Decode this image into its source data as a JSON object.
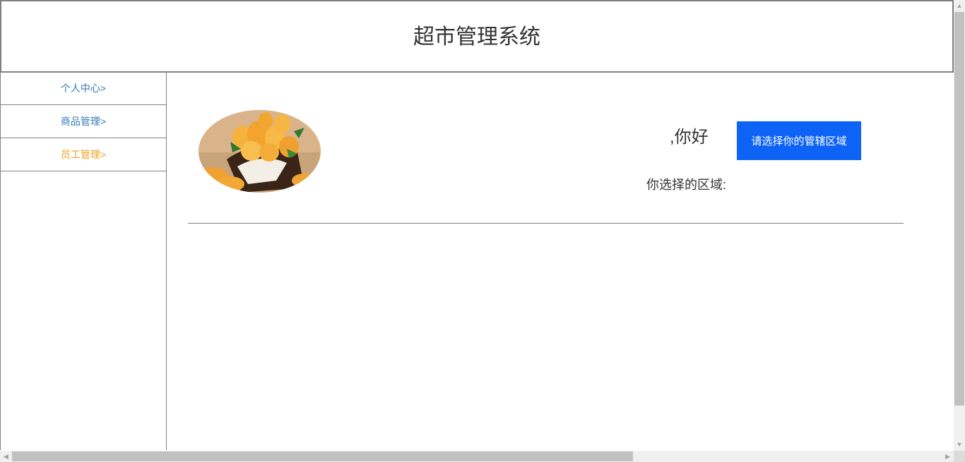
{
  "header": {
    "title": "超市管理系统"
  },
  "sidebar": {
    "items": [
      {
        "label": "个人中心>"
      },
      {
        "label": "商品管理>"
      },
      {
        "label": "员工管理>"
      }
    ]
  },
  "main": {
    "greeting": ",你好",
    "select_region_button": "请选择你的管辖区域",
    "region_label": "你选择的区域:"
  },
  "icons": {
    "scroll_up": "chevron-up-icon",
    "scroll_down": "chevron-down-icon",
    "scroll_left": "chevron-left-icon",
    "scroll_right": "chevron-right-icon"
  },
  "colors": {
    "accent_button": "#0d63f5",
    "nav_link": "#337ab7",
    "nav_active": "#f0a020"
  }
}
